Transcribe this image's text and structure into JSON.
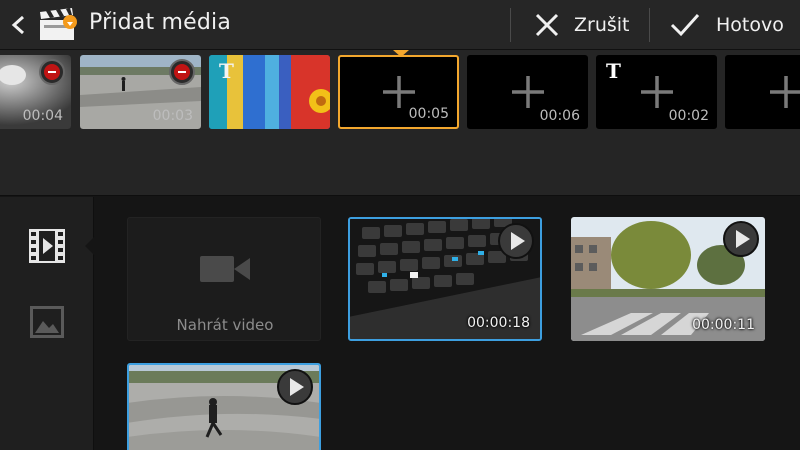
{
  "actionbar": {
    "title": "Přidat média",
    "cancel_label": "Zrušit",
    "done_label": "Hotovo"
  },
  "timeline": {
    "clips": [
      {
        "kind": "video",
        "duration": "00:04",
        "removable": true
      },
      {
        "kind": "video",
        "duration": "00:03",
        "removable": true
      },
      {
        "kind": "image",
        "duration": "",
        "text_overlay": true
      },
      {
        "kind": "empty",
        "duration": "00:05",
        "selected": true
      },
      {
        "kind": "empty",
        "duration": "00:06"
      },
      {
        "kind": "empty",
        "duration": "00:02",
        "text_overlay": true
      },
      {
        "kind": "empty",
        "duration": ""
      }
    ],
    "text_overlay_mark": "T"
  },
  "nav": {
    "items": [
      {
        "name": "videos",
        "icon": "film-icon",
        "active": true
      },
      {
        "name": "images",
        "icon": "image-icon",
        "active": false
      }
    ]
  },
  "media": {
    "capture_label": "Nahrát video",
    "videos": [
      {
        "duration": "00:00:18",
        "selected": true
      },
      {
        "duration": "00:00:11",
        "selected": false
      },
      {
        "duration": "",
        "selected": true
      }
    ]
  },
  "colors": {
    "accent_selected_timeline": "#f3a72e",
    "accent_selected_media": "#3d9fe0",
    "remove_red": "#c01414"
  }
}
